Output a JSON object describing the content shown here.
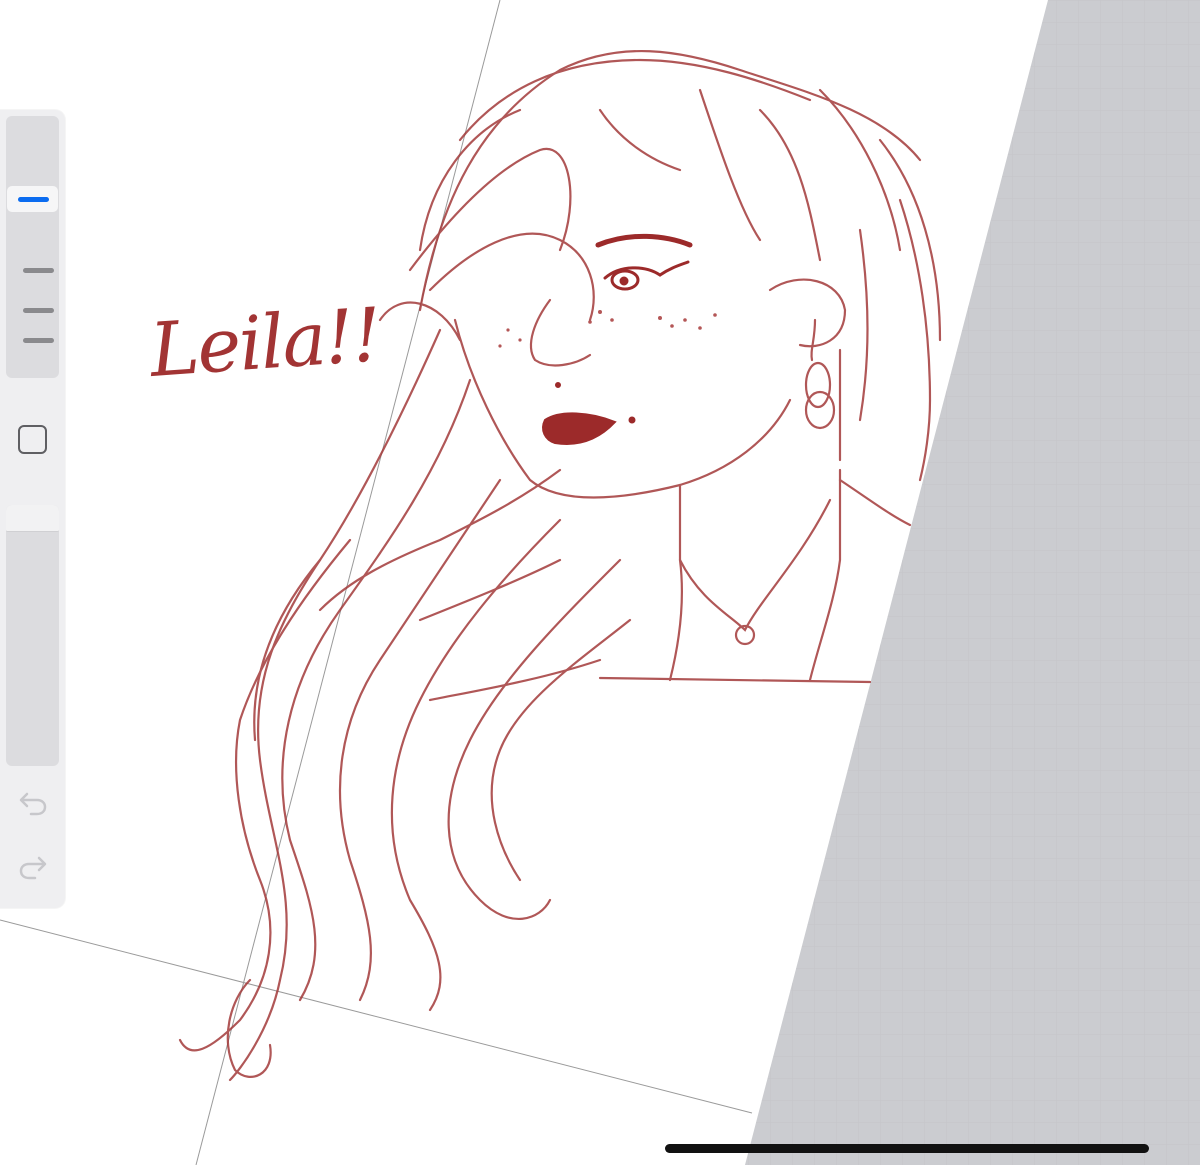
{
  "app": {
    "canvas_label": "",
    "ink_color": "#a33a3a",
    "accent_color": "#0b6cf0",
    "workspace_gray": "#cacbce"
  },
  "drawing": {
    "caption_text": "Leila!!"
  },
  "sidebar": {
    "brush_size_slider": {
      "icon": "brush-size-slider",
      "selected_color": "#0b6cf0"
    },
    "modifier_icon": "square-icon",
    "opacity_slider": {
      "icon": "opacity-slider"
    },
    "undo_icon": "undo-icon",
    "redo_icon": "redo-icon"
  }
}
